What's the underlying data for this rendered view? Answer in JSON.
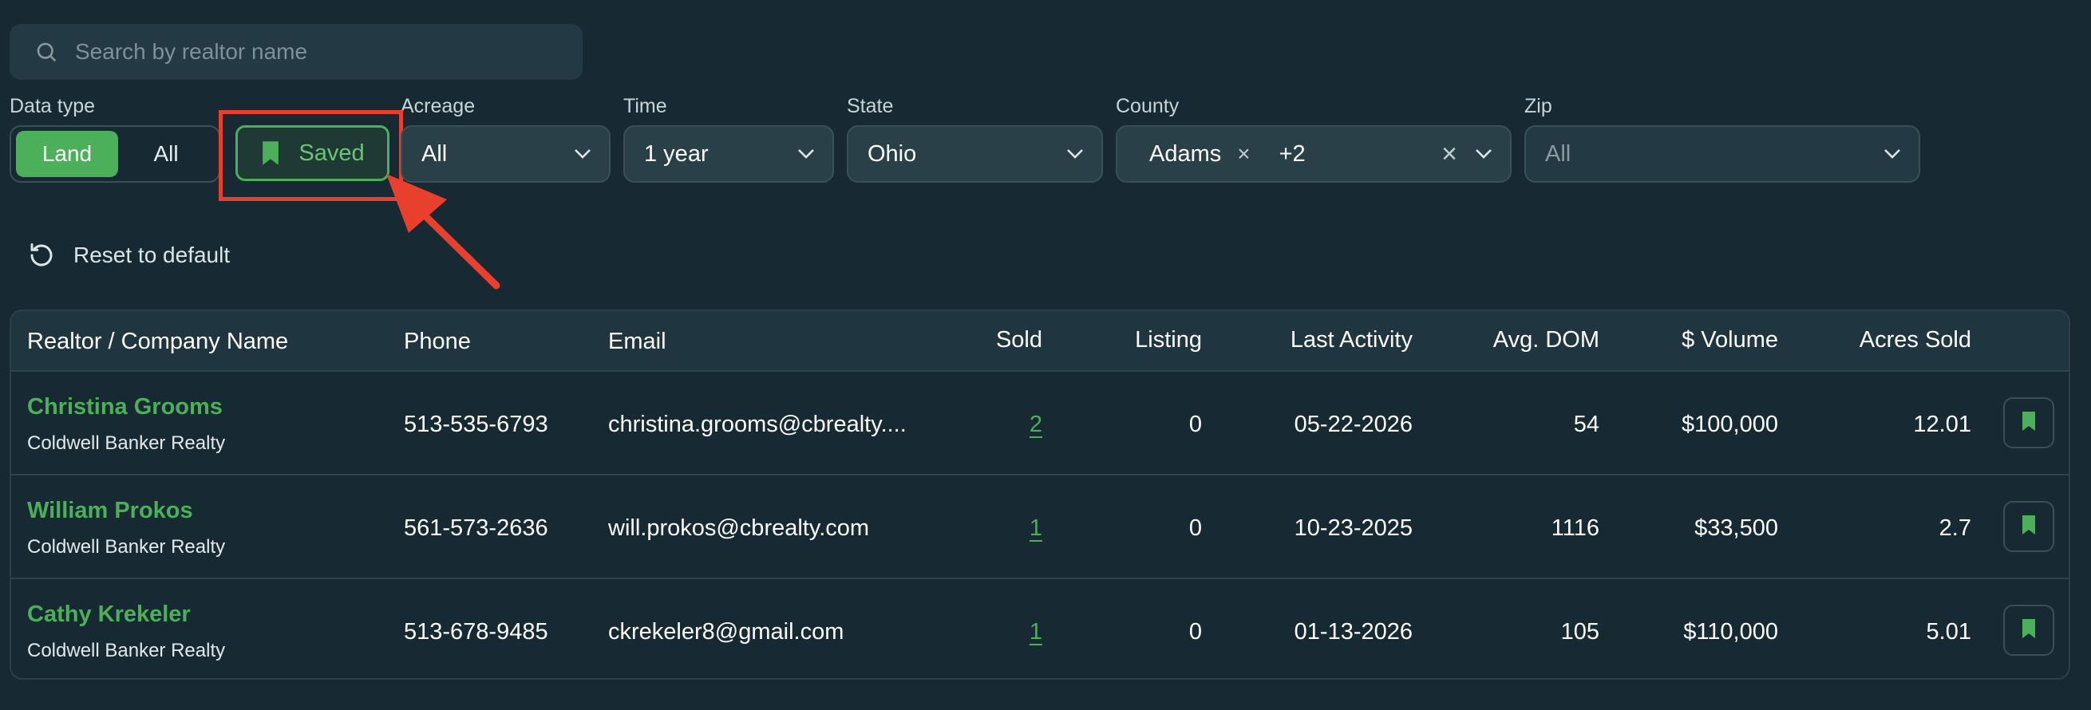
{
  "search": {
    "placeholder": "Search by realtor name"
  },
  "filters": {
    "data_type": {
      "label": "Data type",
      "options": [
        "Land",
        "All"
      ],
      "selected": "Land"
    },
    "saved_label": "Saved",
    "acreage": {
      "label": "Acreage",
      "value": "All"
    },
    "time": {
      "label": "Time",
      "value": "1 year"
    },
    "state": {
      "label": "State",
      "value": "Ohio"
    },
    "county": {
      "label": "County",
      "chip": "Adams",
      "more": "+2"
    },
    "zip": {
      "label": "Zip",
      "placeholder": "All"
    }
  },
  "reset_label": "Reset to default",
  "table": {
    "headers": [
      "Realtor / Company Name",
      "Phone",
      "Email",
      "Sold",
      "Listing",
      "Last Activity",
      "Avg. DOM",
      "$ Volume",
      "Acres Sold"
    ],
    "rows": [
      {
        "name": "Christina Grooms",
        "company": "Coldwell Banker Realty",
        "phone": "513-535-6793",
        "email": "christina.grooms@cbrealty....",
        "sold": "2",
        "listing": "0",
        "last_activity": "05-22-2026",
        "avg_dom": "54",
        "volume": "$100,000",
        "acres": "12.01"
      },
      {
        "name": "William Prokos",
        "company": "Coldwell Banker Realty",
        "phone": "561-573-2636",
        "email": "will.prokos@cbrealty.com",
        "sold": "1",
        "listing": "0",
        "last_activity": "10-23-2025",
        "avg_dom": "1116",
        "volume": "$33,500",
        "acres": "2.7"
      },
      {
        "name": "Cathy Krekeler",
        "company": "Coldwell Banker Realty",
        "phone": "513-678-9485",
        "email": "ckrekeler8@gmail.com",
        "sold": "1",
        "listing": "0",
        "last_activity": "01-13-2026",
        "avg_dom": "105",
        "volume": "$110,000",
        "acres": "5.01"
      }
    ]
  },
  "colors": {
    "accent": "#4caf5a",
    "background": "#172a33",
    "annotation": "#e8402c"
  },
  "icons": [
    "search-icon",
    "bookmark-icon",
    "chevron-down-icon",
    "close-icon",
    "reset-icon"
  ]
}
